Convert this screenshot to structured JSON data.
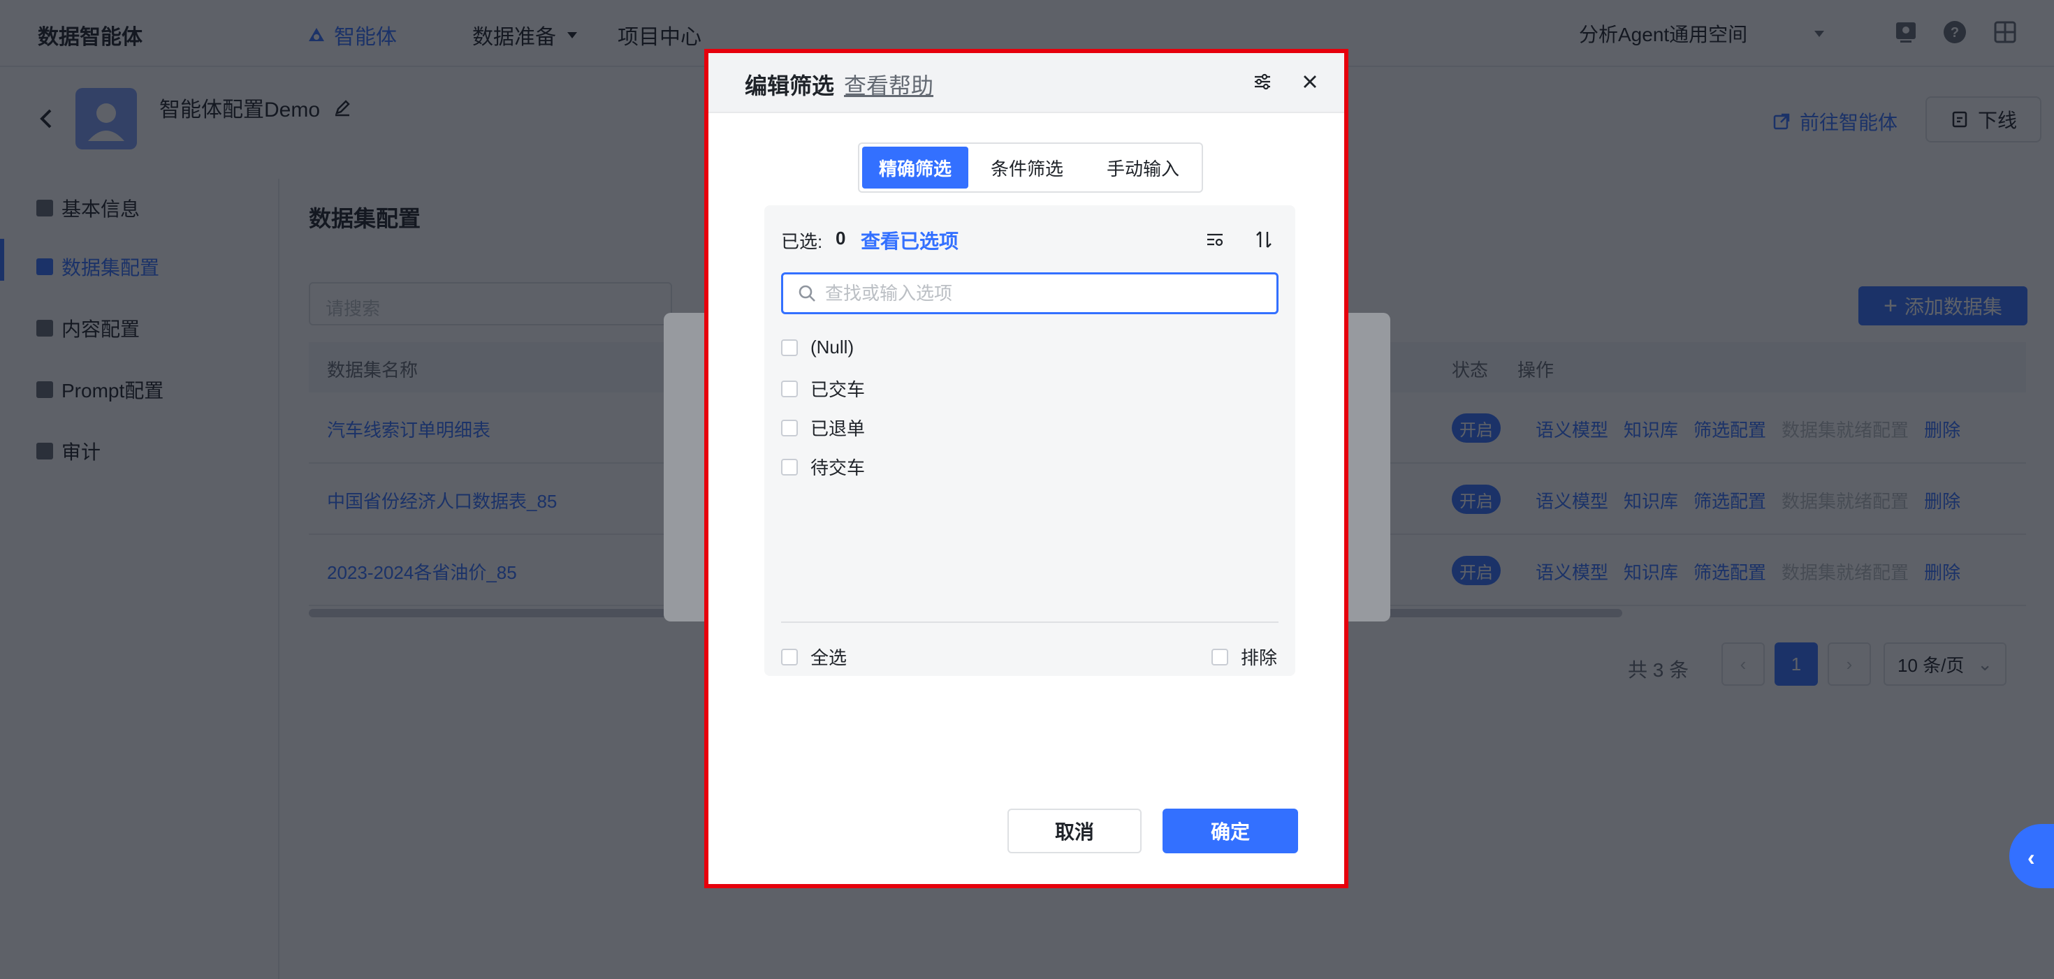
{
  "topnav": {
    "brand": "数据智能体",
    "items": [
      {
        "label": "智能体"
      },
      {
        "label": "数据准备"
      },
      {
        "label": "项目中心"
      }
    ],
    "workspace": "分析Agent通用空间"
  },
  "header": {
    "agent_name": "智能体配置Demo",
    "goto_agent": "前往智能体",
    "offline": "下线"
  },
  "sidebar": {
    "items": [
      {
        "label": "基本信息"
      },
      {
        "label": "数据集配置"
      },
      {
        "label": "内容配置"
      },
      {
        "label": "Prompt配置"
      },
      {
        "label": "审计"
      }
    ]
  },
  "main": {
    "section_title": "数据集配置",
    "search_placeholder": "请搜索",
    "add_button": "添加数据集",
    "columns": {
      "name": "数据集名称",
      "status": "状态",
      "ops": "操作"
    },
    "rows": [
      {
        "name": "汽车线索订单明细表",
        "status": "开启"
      },
      {
        "name": "中国省份经济人口数据表_85",
        "status": "开启"
      },
      {
        "name": "2023-2024各省油价_85",
        "status": "开启"
      }
    ],
    "ops": [
      "语义模型",
      "知识库",
      "筛选配置",
      "数据集就绪配置",
      "删除"
    ],
    "pagination": {
      "total": "共 3 条",
      "current": "1",
      "page_size": "10 条/页"
    }
  },
  "dialog": {
    "title": "编辑筛选",
    "help": "查看帮助",
    "tabs": [
      {
        "label": "精确筛选"
      },
      {
        "label": "条件筛选"
      },
      {
        "label": "手动输入"
      }
    ],
    "selected_label": "已选:",
    "selected_count": "0",
    "view_selected": "查看已选项",
    "search_placeholder": "查找或输入选项",
    "options": [
      {
        "label": "(Null)"
      },
      {
        "label": "已交车"
      },
      {
        "label": "已退单"
      },
      {
        "label": "待交车"
      }
    ],
    "select_all": "全选",
    "exclude": "排除",
    "cancel": "取消",
    "confirm": "确定"
  },
  "colors": {
    "accent": "#3370ff",
    "highlight_border": "#e6000c"
  }
}
